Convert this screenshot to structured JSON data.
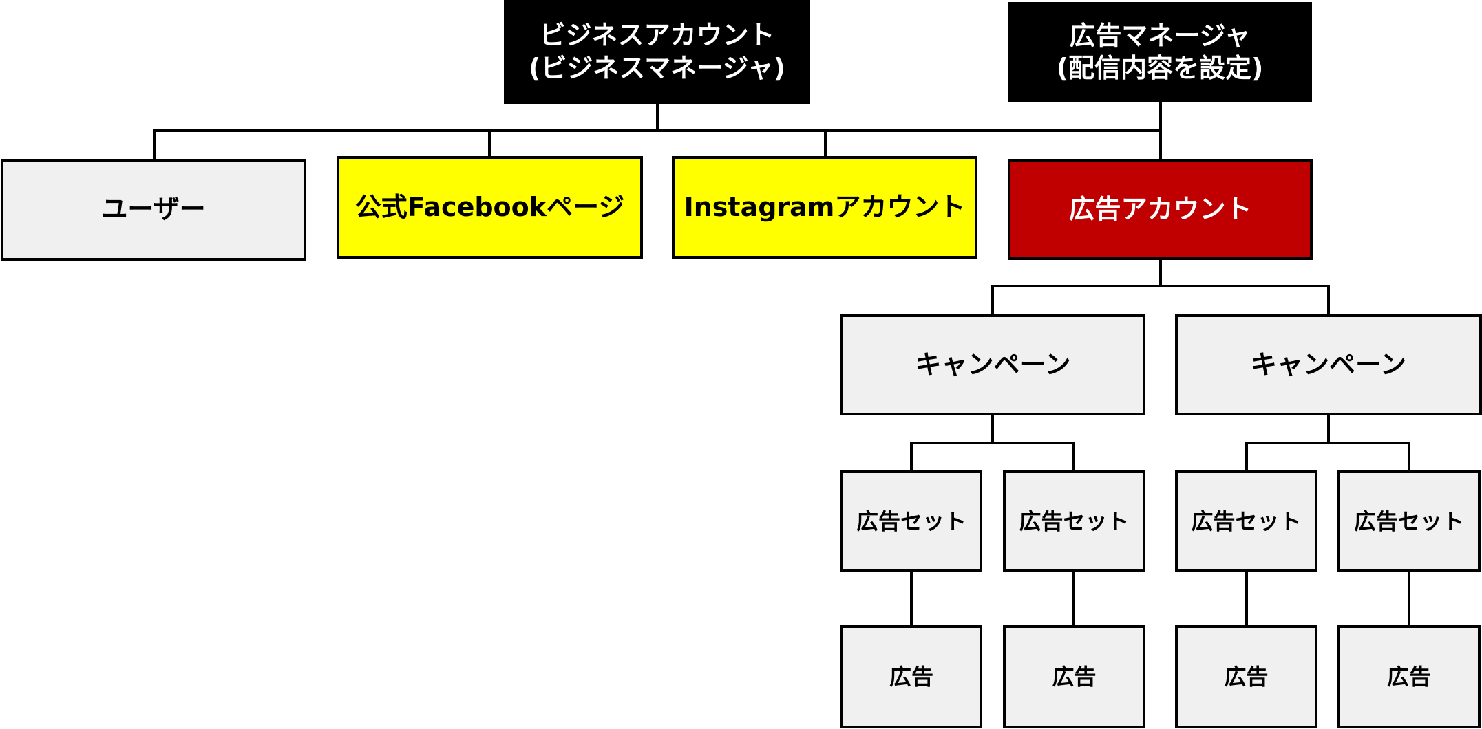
{
  "diagram": {
    "business_account": {
      "line1": "ビジネスアカウント",
      "line2": "(ビジネスマネージャ)"
    },
    "ad_manager": {
      "line1": "広告マネージャ",
      "line2": "(配信内容を設定)"
    },
    "user": "ユーザー",
    "facebook_page": "公式Facebookページ",
    "instagram_account": "Instagramアカウント",
    "ad_account": "広告アカウント",
    "campaigns": [
      {
        "label": "キャンペーン",
        "ad_sets": [
          {
            "label": "広告セット",
            "ad": "広告"
          },
          {
            "label": "広告セット",
            "ad": "広告"
          }
        ]
      },
      {
        "label": "キャンペーン",
        "ad_sets": [
          {
            "label": "広告セット",
            "ad": "広告"
          },
          {
            "label": "広告セット",
            "ad": "広告"
          }
        ]
      }
    ],
    "colors": {
      "gray": "#f0f0f0",
      "yellow": "#ffff00",
      "red": "#c00000",
      "black": "#000000"
    }
  }
}
